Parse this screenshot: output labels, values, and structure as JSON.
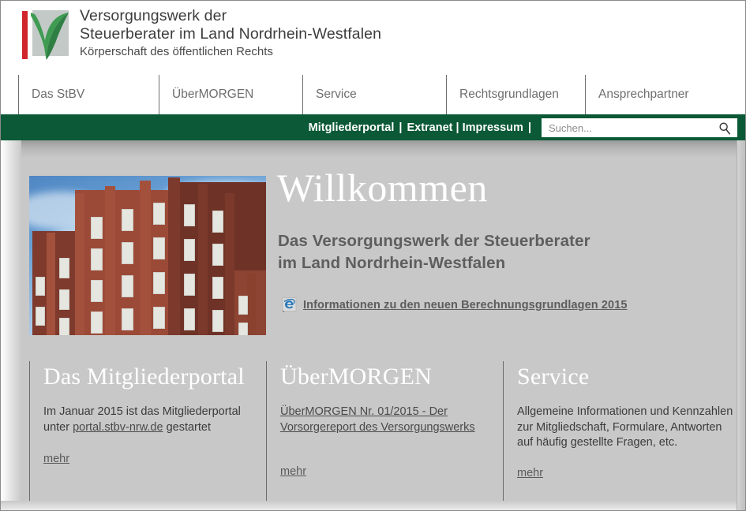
{
  "header": {
    "logo_name": "stbv-nrw-logo",
    "title_line1": "Versorgungswerk der",
    "title_line2": "Steuerberater im Land Nordrhein-Westfalen",
    "title_line3": "Körperschaft des öffentlichen Rechts",
    "colors": {
      "logo_red": "#d0262b",
      "logo_green": "#3f9b52",
      "logo_gray": "#c2c9c6",
      "nav_green": "#0b5936"
    }
  },
  "mainnav": {
    "items": [
      {
        "label": "Das StBV"
      },
      {
        "label": "ÜberMORGEN"
      },
      {
        "label": "Service"
      },
      {
        "label": "Rechtsgrundlagen"
      },
      {
        "label": "Ansprechpartner"
      }
    ]
  },
  "greenbar": {
    "links": [
      {
        "label": "Mitgliederportal"
      },
      {
        "label": "Extranet"
      },
      {
        "label": "Impressum"
      }
    ],
    "separator": "|",
    "trailing_separator": "|",
    "search": {
      "placeholder": "Suchen...",
      "value": "",
      "icon": "search-icon"
    }
  },
  "hero": {
    "photo_alt": "Backsteingebäude des Versorgungswerks",
    "title": "Willkommen",
    "subtitle_line1": "Das Versorgungswerk der Steuerberater",
    "subtitle_line2": "im Land Nordrhein-Westfalen",
    "link_icon": "internet-explorer-shortcut-icon",
    "link_text": "Informationen zu den neuen Berechnungsgrundlagen 2015"
  },
  "columns": [
    {
      "title": "Das Mitgliederportal",
      "body_prefix": "Im Januar 2015 ist das Mitgliederportal unter ",
      "body_link": "portal.stbv-nrw.de",
      "body_suffix": " gestartet",
      "more": "mehr"
    },
    {
      "title": "ÜberMORGEN",
      "body_link": "ÜberMORGEN Nr. 01/2015 - Der Vorsorgereport des Versorgungswerks",
      "more": "mehr"
    },
    {
      "title": "Service",
      "body_text": "Allgemeine Informationen und Kennzahlen zur Mitgliedschaft, Formulare, Antworten auf häufig gestellte Fragen, etc.",
      "more": "mehr"
    }
  ]
}
